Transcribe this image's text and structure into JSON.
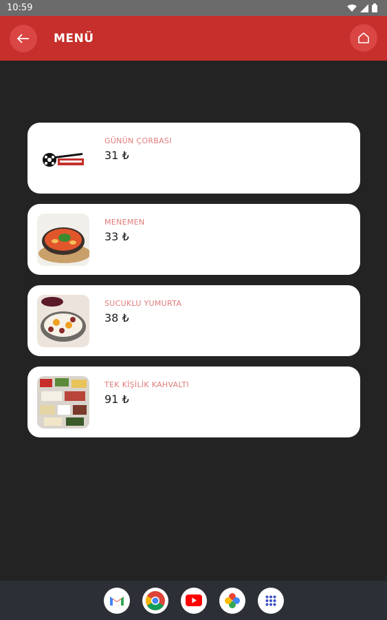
{
  "status_bar": {
    "time": "10:59"
  },
  "appbar": {
    "title": "MENÜ"
  },
  "menu": {
    "items": [
      {
        "name": "GÜNÜN ÇORBASI",
        "price": "31 ₺",
        "image": "sunset-logo"
      },
      {
        "name": "MENEMEN",
        "price": "33 ₺",
        "image": "menemen-pan"
      },
      {
        "name": "SUCUKLU YUMURTA",
        "price": "38 ₺",
        "image": "sucuklu-yumurta-pan"
      },
      {
        "name": "TEK KİŞİLİK KAHVALTI",
        "price": "91 ₺",
        "image": "breakfast-platter"
      }
    ]
  },
  "dock": {
    "apps": [
      "gmail-icon",
      "chrome-icon",
      "youtube-icon",
      "photos-icon",
      "app-drawer-icon"
    ]
  },
  "colors": {
    "appbar": "#c62f2b",
    "background": "#232323",
    "item_name": "#e07a7a"
  }
}
